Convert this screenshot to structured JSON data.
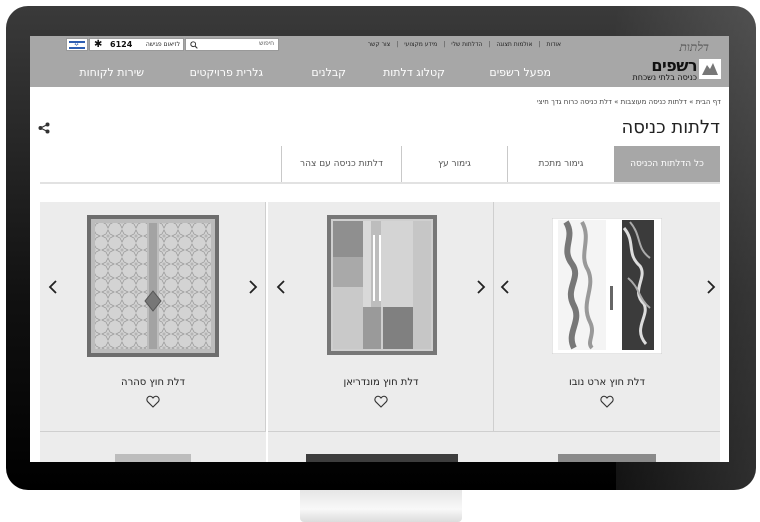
{
  "header": {
    "logo_main": "רשפים",
    "logo_script": "דלתות",
    "logo_sub": "כניסה בלתי נשכחת",
    "top_links": [
      "אודות",
      "אולמות תצוגה",
      "הדלתות שלי",
      "מידע מקצועי",
      "צור קשר"
    ],
    "search_placeholder": "חיפוש",
    "phone_label": "לזיאום פגישה",
    "phone_number": "6124",
    "phone_star": "✱",
    "nav": [
      "מפעל רשפים",
      "קטלוג דלתות",
      "קבלנים",
      "גלרית פרויקטים",
      "שירות לקוחות"
    ]
  },
  "breadcrumb": "דף הבית » דלתות כניסה מעוצבות » דלת כניסה כרוח גדך חיצי",
  "page_title": "דלתות כניסה",
  "tabs": [
    {
      "label": "כל הדלתות הכניסה",
      "active": true
    },
    {
      "label": "גימור מתכת",
      "active": false
    },
    {
      "label": "גימור עץ",
      "active": false
    },
    {
      "label": "דלתות כניסה עם צהר",
      "active": false
    }
  ],
  "products": [
    {
      "title": "דלת חוץ ארט נובו"
    },
    {
      "title": "דלת חוץ מונדריאן"
    },
    {
      "title": "דלת חוץ סהרה"
    }
  ],
  "colors": {
    "header_bg": "#a7a7a7",
    "card_bg": "#ececec",
    "tab_active_bg": "#a7a7a7"
  }
}
